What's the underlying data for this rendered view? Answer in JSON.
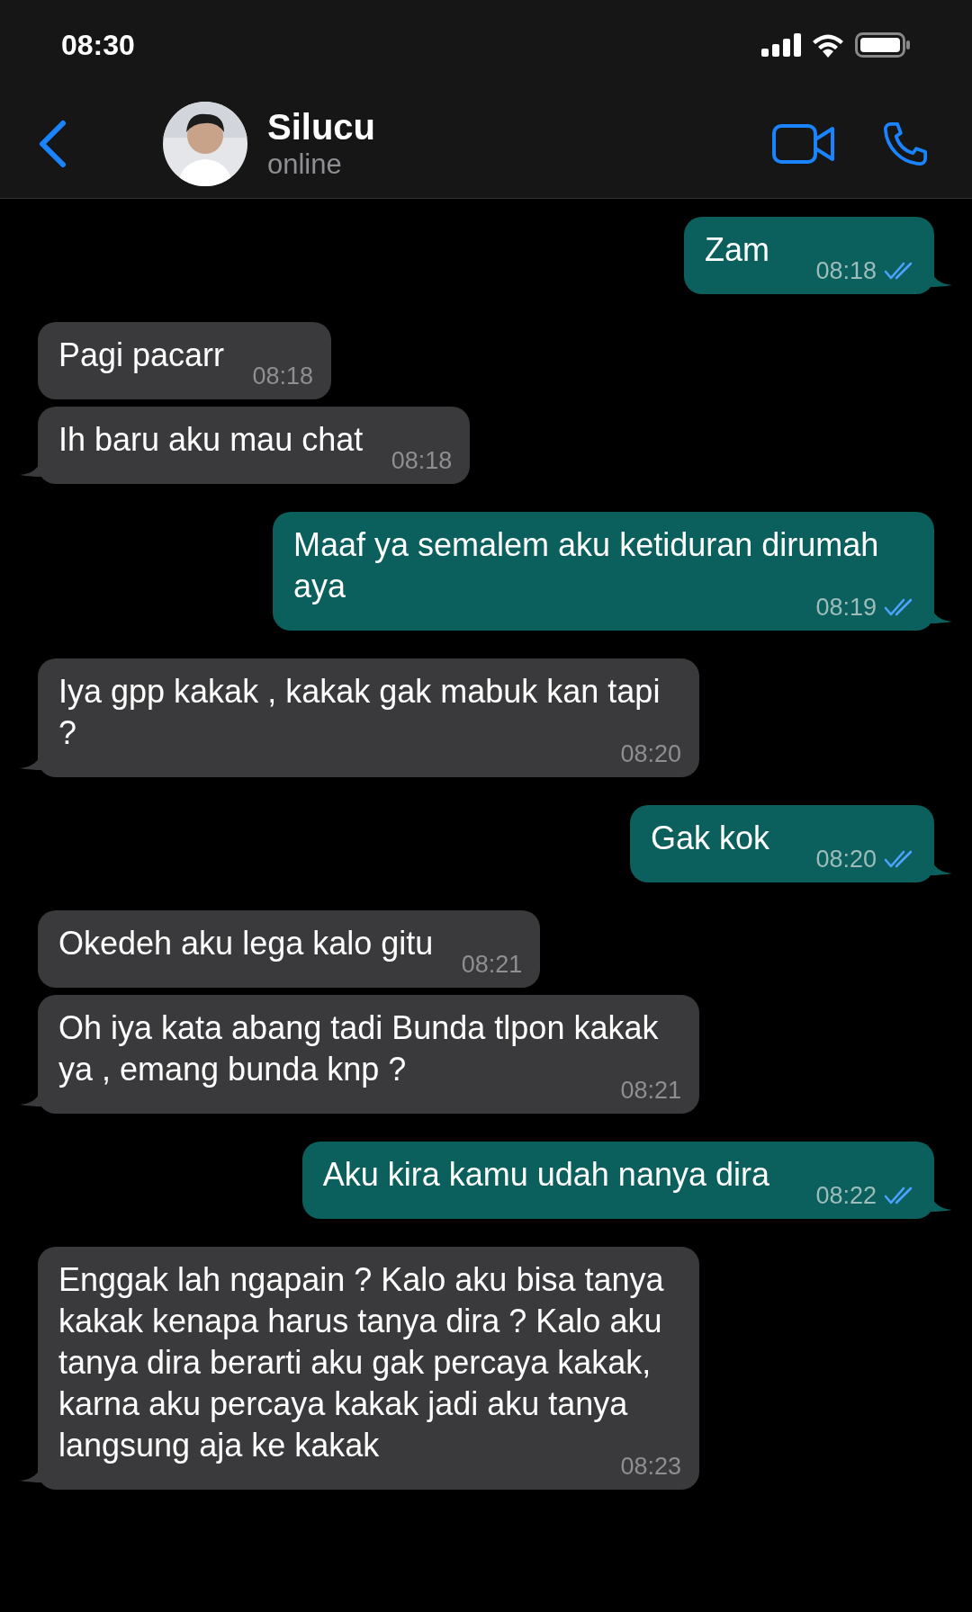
{
  "status_bar": {
    "time": "08:30"
  },
  "header": {
    "name": "Silucu",
    "status": "online"
  },
  "messages": [
    {
      "kind": "outgoing",
      "text": "Zam",
      "time": "08:18",
      "read": true,
      "tail": true
    },
    {
      "kind": "incoming",
      "text": "Pagi pacarr",
      "time": "08:18",
      "tail": false
    },
    {
      "kind": "incoming",
      "text": "Ih baru aku mau chat",
      "time": "08:18",
      "tail": true
    },
    {
      "kind": "outgoing",
      "text": "Maaf ya semalem aku ketiduran dirumah aya",
      "time": "08:19",
      "read": true,
      "tail": true
    },
    {
      "kind": "incoming",
      "text": "Iya gpp kakak , kakak gak mabuk kan tapi ?",
      "time": "08:20",
      "tail": true
    },
    {
      "kind": "outgoing",
      "text": "Gak kok",
      "time": "08:20",
      "read": true,
      "tail": true
    },
    {
      "kind": "incoming",
      "text": "Okedeh aku lega kalo gitu",
      "time": "08:21",
      "tail": false
    },
    {
      "kind": "incoming",
      "text": "Oh iya kata abang tadi Bunda tlpon kakak ya , emang bunda knp ?",
      "time": "08:21",
      "tail": true
    },
    {
      "kind": "outgoing",
      "text": "Aku kira kamu udah nanya dira",
      "time": "08:22",
      "read": true,
      "tail": true
    },
    {
      "kind": "incoming",
      "text": "Enggak lah ngapain ? Kalo aku bisa tanya kakak kenapa harus tanya dira ? Kalo aku tanya dira berarti aku gak percaya kakak, karna aku percaya kakak jadi aku tanya langsung aja ke kakak",
      "time": "08:23",
      "tail": true
    }
  ]
}
